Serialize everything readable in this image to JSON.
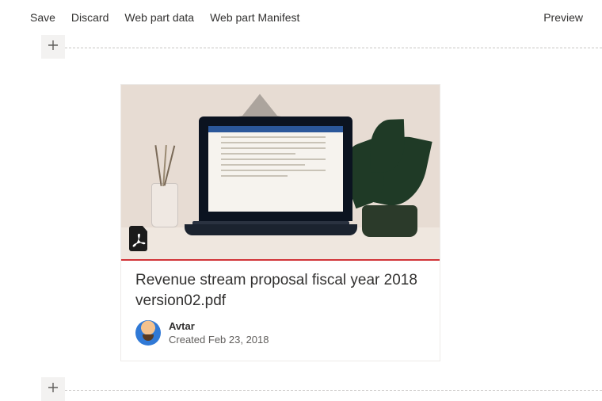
{
  "toolbar": {
    "save": "Save",
    "discard": "Discard",
    "webpart_data": "Web part data",
    "webpart_manifest": "Web part Manifest",
    "preview": "Preview"
  },
  "card": {
    "title": "Revenue stream proposal fiscal year 2018 version02.pdf",
    "author": "Avtar",
    "created_prefix": "Created ",
    "created_date": "Feb 23, 2018",
    "file_type_icon": "pdf-file-icon"
  }
}
